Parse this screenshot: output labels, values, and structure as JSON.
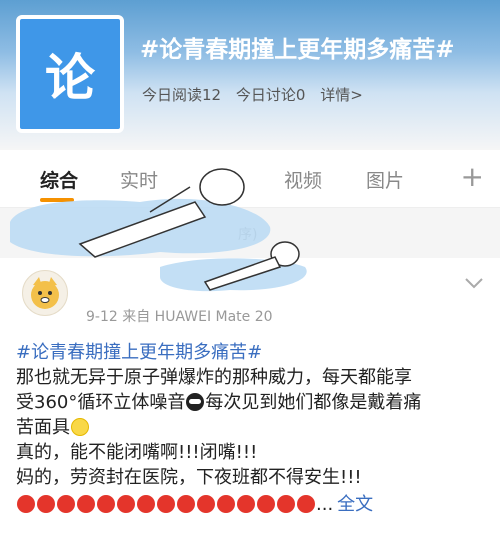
{
  "topic": {
    "logo_char": "论",
    "title": "#论青春期撞上更年期多痛苦#",
    "read_count": "今日阅读12",
    "discuss_count": "今日讨论0",
    "detail_link": "详情>"
  },
  "tabs": [
    {
      "label": "综合",
      "active": true
    },
    {
      "label": "实时",
      "active": false
    },
    {
      "label": "视频",
      "active": false
    },
    {
      "label": "图片",
      "active": false
    }
  ],
  "tab_add": "+",
  "filter_text": "序)",
  "post": {
    "meta": "9-12  来自 HUAWEI Mate 20",
    "hashtag": "#论青春期撞上更年期多痛苦#",
    "line1": "那也就无异于原子弹爆炸的那种威力，每天都能享",
    "line2a": "受360°循环立体噪音",
    "line2b": "每次见到她们都像是戴着痛",
    "line3": "苦面具",
    "line4": "真的，能不能闭嘴啊!!!闭嘴!!!",
    "line5": "妈的，劳资封在医院，下夜班都不得安生!!!",
    "ellipsis": "...",
    "more_label": "全文",
    "angry_emoji_count": 15
  },
  "colors": {
    "accent": "#f59100",
    "link": "#3a6ec0",
    "logo_bg": "#3f97e8"
  }
}
